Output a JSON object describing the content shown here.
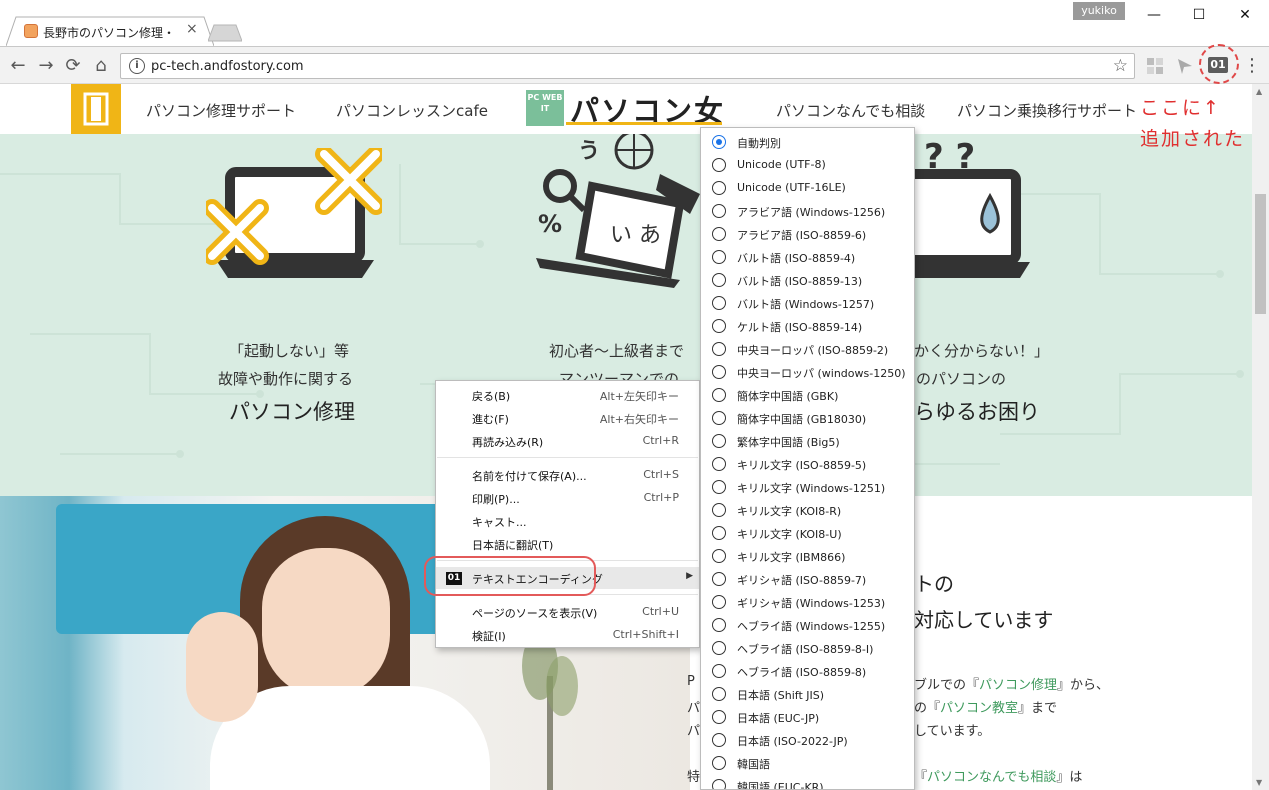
{
  "window": {
    "tab_title": "長野市のパソコン修理・パソ",
    "tab_close": "×",
    "user": "yukiko",
    "minimize": "—",
    "maximize": "☐",
    "close": "✕"
  },
  "toolbar": {
    "url": "pc-tech.andfostory.com",
    "back": "←",
    "forward": "→",
    "reload": "⟳",
    "home": "⌂",
    "star": "☆",
    "info": "i",
    "extension_label": "01",
    "menu": "⋮"
  },
  "site": {
    "nav": [
      "パソコン修理サポート",
      "パソコンレッスンcafe",
      "パソコンなんでも相談",
      "パソコン乗換移行サポート"
    ],
    "brand_small": "PC WEB IT",
    "brand": "パソコン女",
    "hero": {
      "col1_line1": "「起動しない」等",
      "col1_line2": "故障や動作に関する",
      "col1_title": "パソコン修理",
      "col2_line1": "初心者〜上級者まで",
      "col2_line2": "マンツーマンでの",
      "col3_line1": "かく分からない！」",
      "col3_line2": "のパソコンの",
      "col3_title": "らゆるお困り"
    },
    "section_title_line1": "トの",
    "section_title_line2": "対応しています",
    "body": {
      "line1_prefix": "P",
      "line1_mid": "ブルでの『",
      "line1_link": "パソコン修理",
      "line1_suffix": "』から、",
      "line2_prefix": "パ",
      "line2_mid": "の『",
      "line2_link": "パソコン教室",
      "line2_suffix": "』まで",
      "line3_prefix": "パ",
      "line3_mid": "しています。",
      "line4_prefix": "特",
      "line4_mid": "『",
      "line4_link": "パソコンなんでも相談",
      "line4_suffix": "』は"
    }
  },
  "context_menu": {
    "items": [
      {
        "label": "戻る(B)",
        "shortcut": "Alt+左矢印キー"
      },
      {
        "label": "進む(F)",
        "shortcut": "Alt+右矢印キー"
      },
      {
        "label": "再読み込み(R)",
        "shortcut": "Ctrl+R"
      },
      {
        "label": "名前を付けて保存(A)...",
        "shortcut": "Ctrl+S"
      },
      {
        "label": "印刷(P)...",
        "shortcut": "Ctrl+P"
      },
      {
        "label": "キャスト...",
        "shortcut": ""
      },
      {
        "label": "日本語に翻訳(T)",
        "shortcut": ""
      },
      {
        "label": "テキストエンコーディング",
        "shortcut": "",
        "icon": "01",
        "submenu_arrow": "▶"
      },
      {
        "label": "ページのソースを表示(V)",
        "shortcut": "Ctrl+U"
      },
      {
        "label": "検証(I)",
        "shortcut": "Ctrl+Shift+I"
      }
    ]
  },
  "encoding_menu": {
    "selected": "自動判別",
    "items": [
      "自動判別",
      "Unicode (UTF-8)",
      "Unicode (UTF-16LE)",
      "アラビア語 (Windows-1256)",
      "アラビア語 (ISO-8859-6)",
      "バルト語 (ISO-8859-4)",
      "バルト語 (ISO-8859-13)",
      "バルト語 (Windows-1257)",
      "ケルト語 (ISO-8859-14)",
      "中央ヨーロッパ (ISO-8859-2)",
      "中央ヨーロッパ (windows-1250)",
      "簡体字中国語 (GBK)",
      "簡体字中国語 (GB18030)",
      "繁体字中国語 (Big5)",
      "キリル文字 (ISO-8859-5)",
      "キリル文字 (Windows-1251)",
      "キリル文字 (KOI8-R)",
      "キリル文字 (KOI8-U)",
      "キリル文字 (IBM866)",
      "ギリシャ語 (ISO-8859-7)",
      "ギリシャ語 (Windows-1253)",
      "ヘブライ語 (Windows-1255)",
      "ヘブライ語 (ISO-8859-8-I)",
      "ヘブライ語 (ISO-8859-8)",
      "日本語 (Shift JIS)",
      "日本語 (EUC-JP)",
      "日本語 (ISO-2022-JP)",
      "韓国語",
      "韓国語 (EUC-KR)"
    ]
  },
  "annotation": {
    "line1": "ここに↑",
    "line2": "追加された"
  },
  "colors": {
    "accent_yellow": "#f0b516",
    "hero_bg": "#d9ece2",
    "link_green": "#3f9a5d",
    "annotation_red": "#e02f2f",
    "radio_blue": "#1a73e8"
  }
}
